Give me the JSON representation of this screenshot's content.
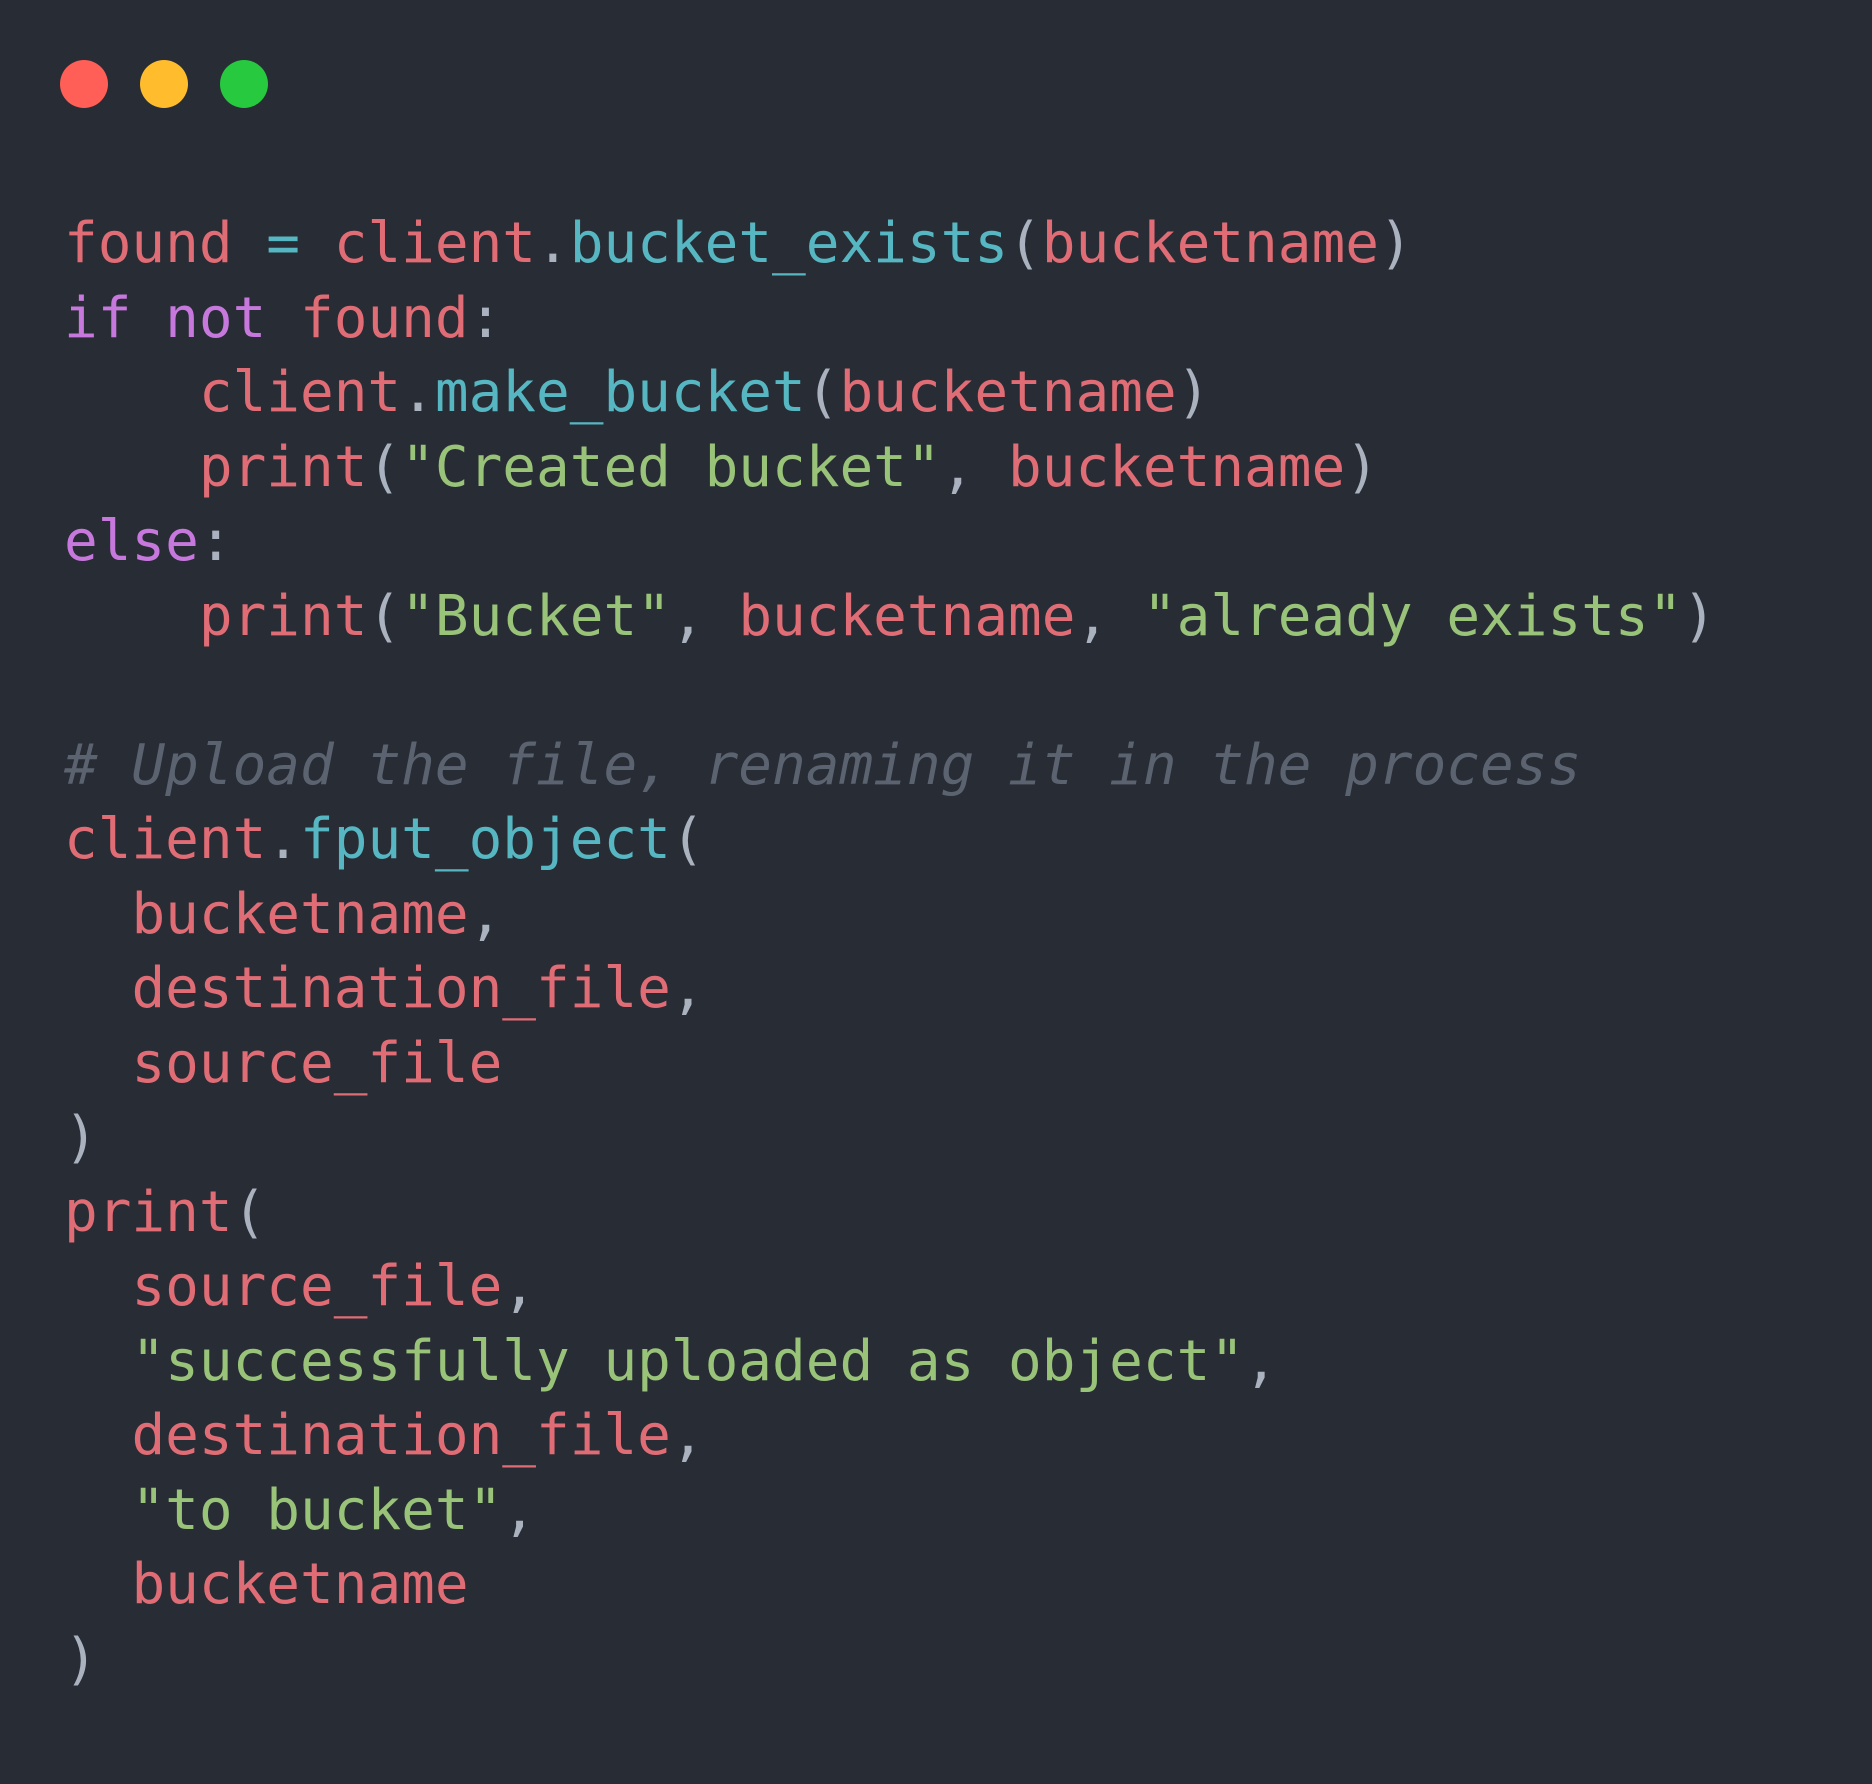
{
  "window": {
    "background": "#282c34",
    "controls": [
      {
        "name": "close-button",
        "color": "#ff5f56"
      },
      {
        "name": "minimize-button",
        "color": "#ffbd2e"
      },
      {
        "name": "maximize-button",
        "color": "#27c93f"
      }
    ]
  },
  "colors": {
    "variable": "#e06c75",
    "function": "#56b6c2",
    "keyword": "#c678dd",
    "string": "#98c379",
    "comment": "#5c6370",
    "punctuation": "#abb2bf"
  },
  "code": {
    "language": "python",
    "lines": [
      [
        [
          "variable",
          "found"
        ],
        [
          "punctuation",
          " "
        ],
        [
          "function",
          "="
        ],
        [
          "punctuation",
          " "
        ],
        [
          "variable",
          "client"
        ],
        [
          "punctuation",
          "."
        ],
        [
          "function",
          "bucket_exists"
        ],
        [
          "punctuation",
          "("
        ],
        [
          "variable",
          "bucketname"
        ],
        [
          "punctuation",
          ")"
        ]
      ],
      [
        [
          "keyword",
          "if"
        ],
        [
          "punctuation",
          " "
        ],
        [
          "keyword",
          "not"
        ],
        [
          "punctuation",
          " "
        ],
        [
          "variable",
          "found"
        ],
        [
          "punctuation",
          ":"
        ]
      ],
      [
        [
          "punctuation",
          "    "
        ],
        [
          "variable",
          "client"
        ],
        [
          "punctuation",
          "."
        ],
        [
          "function",
          "make_bucket"
        ],
        [
          "punctuation",
          "("
        ],
        [
          "variable",
          "bucketname"
        ],
        [
          "punctuation",
          ")"
        ]
      ],
      [
        [
          "punctuation",
          "    "
        ],
        [
          "variable",
          "print"
        ],
        [
          "punctuation",
          "("
        ],
        [
          "string",
          "\"Created bucket\""
        ],
        [
          "punctuation",
          ", "
        ],
        [
          "variable",
          "bucketname"
        ],
        [
          "punctuation",
          ")"
        ]
      ],
      [
        [
          "keyword",
          "else"
        ],
        [
          "punctuation",
          ":"
        ]
      ],
      [
        [
          "punctuation",
          "    "
        ],
        [
          "variable",
          "print"
        ],
        [
          "punctuation",
          "("
        ],
        [
          "string",
          "\"Bucket\""
        ],
        [
          "punctuation",
          ", "
        ],
        [
          "variable",
          "bucketname"
        ],
        [
          "punctuation",
          ", "
        ],
        [
          "string",
          "\"already exists\""
        ],
        [
          "punctuation",
          ")"
        ]
      ],
      [],
      [
        [
          "comment",
          "# Upload the file, renaming it in the process"
        ]
      ],
      [
        [
          "variable",
          "client"
        ],
        [
          "punctuation",
          "."
        ],
        [
          "function",
          "fput_object"
        ],
        [
          "punctuation",
          "("
        ]
      ],
      [
        [
          "punctuation",
          "  "
        ],
        [
          "variable",
          "bucketname"
        ],
        [
          "punctuation",
          ","
        ]
      ],
      [
        [
          "punctuation",
          "  "
        ],
        [
          "variable",
          "destination_file"
        ],
        [
          "punctuation",
          ","
        ]
      ],
      [
        [
          "punctuation",
          "  "
        ],
        [
          "variable",
          "source_file"
        ]
      ],
      [
        [
          "punctuation",
          ")"
        ]
      ],
      [
        [
          "variable",
          "print"
        ],
        [
          "punctuation",
          "("
        ]
      ],
      [
        [
          "punctuation",
          "  "
        ],
        [
          "variable",
          "source_file"
        ],
        [
          "punctuation",
          ","
        ]
      ],
      [
        [
          "punctuation",
          "  "
        ],
        [
          "string",
          "\"successfully uploaded as object\""
        ],
        [
          "punctuation",
          ","
        ]
      ],
      [
        [
          "punctuation",
          "  "
        ],
        [
          "variable",
          "destination_file"
        ],
        [
          "punctuation",
          ","
        ]
      ],
      [
        [
          "punctuation",
          "  "
        ],
        [
          "string",
          "\"to bucket\""
        ],
        [
          "punctuation",
          ","
        ]
      ],
      [
        [
          "punctuation",
          "  "
        ],
        [
          "variable",
          "bucketname"
        ]
      ],
      [
        [
          "punctuation",
          ")"
        ]
      ]
    ]
  }
}
